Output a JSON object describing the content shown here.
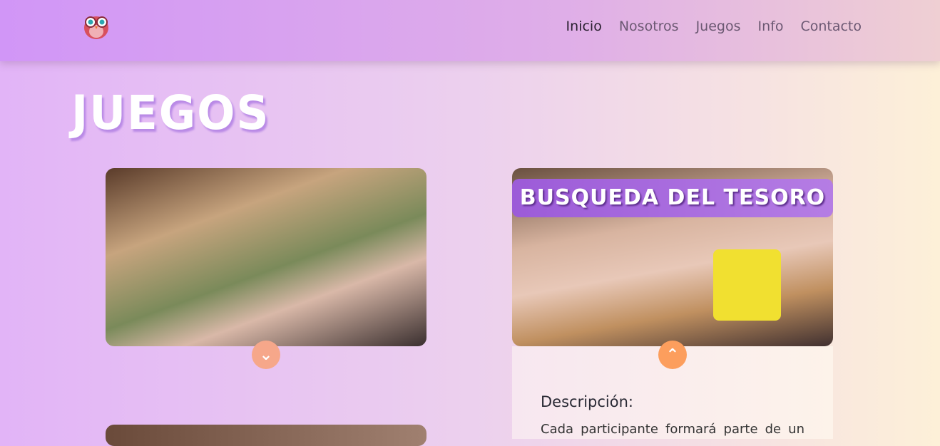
{
  "nav": {
    "items": [
      {
        "label": "Inicio",
        "active": true
      },
      {
        "label": "Nosotros"
      },
      {
        "label": "Juegos"
      },
      {
        "label": "Info"
      },
      {
        "label": "Contacto"
      }
    ]
  },
  "page_title": "JUEGOS",
  "cards": [
    {
      "expanded": false,
      "toggle_icon": "chevron-down-icon"
    },
    {
      "title": "BUSQUEDA DEL TESORO",
      "expanded": true,
      "toggle_icon": "chevron-up-icon",
      "description_heading": "Descripción:",
      "description": "Cada participante formará parte de un"
    }
  ],
  "colors": {
    "accent": "#fc9e5d",
    "banner": "#a465dc"
  }
}
